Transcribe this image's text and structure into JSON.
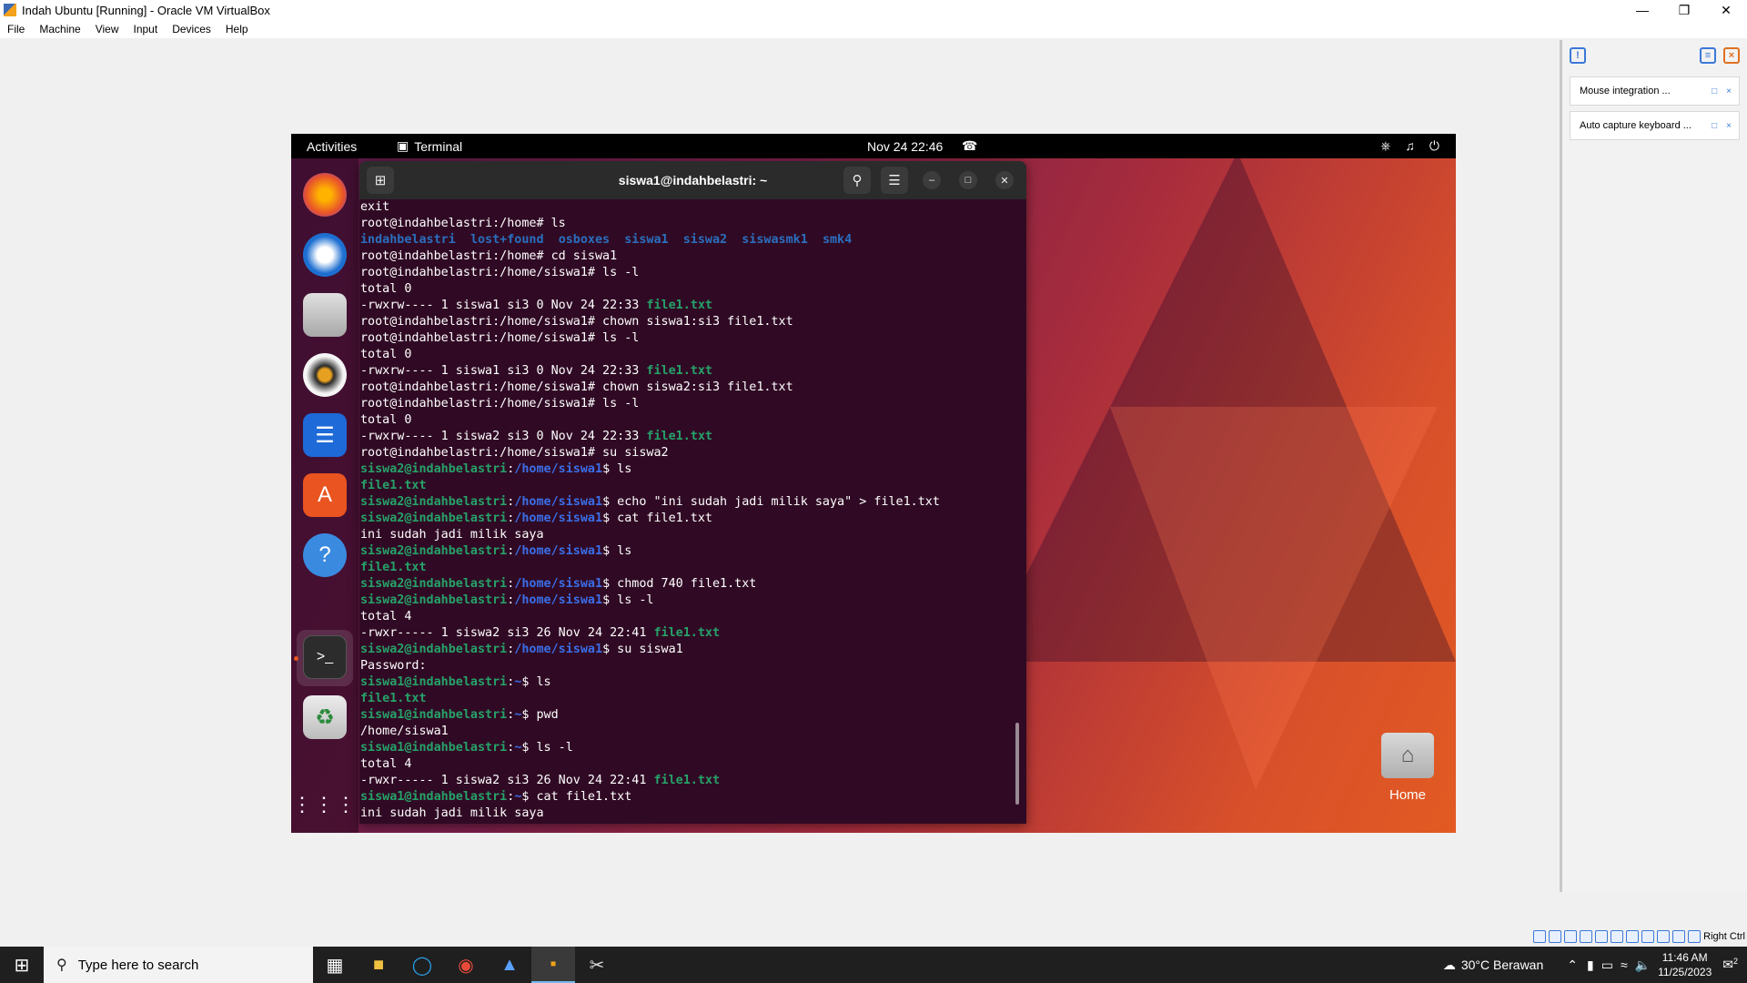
{
  "vbox": {
    "title": "Indah Ubuntu [Running] - Oracle VM VirtualBox",
    "menu": [
      "File",
      "Machine",
      "View",
      "Input",
      "Devices",
      "Help"
    ],
    "notifications": [
      {
        "label": "Mouse integration ..."
      },
      {
        "label": "Auto capture keyboard ..."
      }
    ],
    "host_key": "Right Ctrl"
  },
  "ubuntu": {
    "topbar": {
      "activities": "Activities",
      "app": "Terminal",
      "clock": "Nov 24  22:46"
    },
    "desktop_icon": "Home"
  },
  "terminal": {
    "title": "siswa1@indahbelastri: ~",
    "lines": [
      [
        {
          "t": "exit"
        }
      ],
      [
        {
          "t": "root@indahbelastri:/home# ls"
        }
      ],
      [
        {
          "t": "indahbelastri",
          "c": "d"
        },
        {
          "t": "  "
        },
        {
          "t": "lost+found",
          "c": "d"
        },
        {
          "t": "  "
        },
        {
          "t": "osboxes",
          "c": "d"
        },
        {
          "t": "  "
        },
        {
          "t": "siswa1",
          "c": "d"
        },
        {
          "t": "  "
        },
        {
          "t": "siswa2",
          "c": "d"
        },
        {
          "t": "  "
        },
        {
          "t": "siswasmk1",
          "c": "d"
        },
        {
          "t": "  "
        },
        {
          "t": "smk4",
          "c": "d"
        }
      ],
      [
        {
          "t": "root@indahbelastri:/home# cd siswa1"
        }
      ],
      [
        {
          "t": "root@indahbelastri:/home/siswa1# ls -l"
        }
      ],
      [
        {
          "t": "total 0"
        }
      ],
      [
        {
          "t": "-rwxrw---- 1 siswa1 si3 0 Nov 24 22:33 "
        },
        {
          "t": "file1.txt",
          "c": "g"
        }
      ],
      [
        {
          "t": "root@indahbelastri:/home/siswa1# chown siswa1:si3 file1.txt"
        }
      ],
      [
        {
          "t": "root@indahbelastri:/home/siswa1# ls -l"
        }
      ],
      [
        {
          "t": "total 0"
        }
      ],
      [
        {
          "t": "-rwxrw---- 1 siswa1 si3 0 Nov 24 22:33 "
        },
        {
          "t": "file1.txt",
          "c": "g"
        }
      ],
      [
        {
          "t": "root@indahbelastri:/home/siswa1# chown siswa2:si3 file1.txt"
        }
      ],
      [
        {
          "t": "root@indahbelastri:/home/siswa1# ls -l"
        }
      ],
      [
        {
          "t": "total 0"
        }
      ],
      [
        {
          "t": "-rwxrw---- 1 siswa2 si3 0 Nov 24 22:33 "
        },
        {
          "t": "file1.txt",
          "c": "g"
        }
      ],
      [
        {
          "t": "root@indahbelastri:/home/siswa1# su siswa2"
        }
      ],
      [
        {
          "t": "siswa2@indahbelastri",
          "c": "u"
        },
        {
          "t": ":"
        },
        {
          "t": "/home/siswa1",
          "c": "p"
        },
        {
          "t": "$ ls"
        }
      ],
      [
        {
          "t": "file1.txt",
          "c": "g"
        }
      ],
      [
        {
          "t": "siswa2@indahbelastri",
          "c": "u"
        },
        {
          "t": ":"
        },
        {
          "t": "/home/siswa1",
          "c": "p"
        },
        {
          "t": "$ echo \"ini sudah jadi milik saya\" > file1.txt"
        }
      ],
      [
        {
          "t": "siswa2@indahbelastri",
          "c": "u"
        },
        {
          "t": ":"
        },
        {
          "t": "/home/siswa1",
          "c": "p"
        },
        {
          "t": "$ cat file1.txt"
        }
      ],
      [
        {
          "t": "ini sudah jadi milik saya"
        }
      ],
      [
        {
          "t": "siswa2@indahbelastri",
          "c": "u"
        },
        {
          "t": ":"
        },
        {
          "t": "/home/siswa1",
          "c": "p"
        },
        {
          "t": "$ ls"
        }
      ],
      [
        {
          "t": "file1.txt",
          "c": "g"
        }
      ],
      [
        {
          "t": "siswa2@indahbelastri",
          "c": "u"
        },
        {
          "t": ":"
        },
        {
          "t": "/home/siswa1",
          "c": "p"
        },
        {
          "t": "$ chmod 740 file1.txt"
        }
      ],
      [
        {
          "t": "siswa2@indahbelastri",
          "c": "u"
        },
        {
          "t": ":"
        },
        {
          "t": "/home/siswa1",
          "c": "p"
        },
        {
          "t": "$ ls -l"
        }
      ],
      [
        {
          "t": "total 4"
        }
      ],
      [
        {
          "t": "-rwxr----- 1 siswa2 si3 26 Nov 24 22:41 "
        },
        {
          "t": "file1.txt",
          "c": "g"
        }
      ],
      [
        {
          "t": "siswa2@indahbelastri",
          "c": "u"
        },
        {
          "t": ":"
        },
        {
          "t": "/home/siswa1",
          "c": "p"
        },
        {
          "t": "$ su siswa1"
        }
      ],
      [
        {
          "t": "Password:"
        }
      ],
      [
        {
          "t": "siswa1@indahbelastri",
          "c": "u"
        },
        {
          "t": ":"
        },
        {
          "t": "~",
          "c": "p"
        },
        {
          "t": "$ ls"
        }
      ],
      [
        {
          "t": "file1.txt",
          "c": "g"
        }
      ],
      [
        {
          "t": "siswa1@indahbelastri",
          "c": "u"
        },
        {
          "t": ":"
        },
        {
          "t": "~",
          "c": "p"
        },
        {
          "t": "$ pwd"
        }
      ],
      [
        {
          "t": "/home/siswa1"
        }
      ],
      [
        {
          "t": "siswa1@indahbelastri",
          "c": "u"
        },
        {
          "t": ":"
        },
        {
          "t": "~",
          "c": "p"
        },
        {
          "t": "$ ls -l"
        }
      ],
      [
        {
          "t": "total 4"
        }
      ],
      [
        {
          "t": "-rwxr----- 1 siswa2 si3 26 Nov 24 22:41 "
        },
        {
          "t": "file1.txt",
          "c": "g"
        }
      ],
      [
        {
          "t": "siswa1@indahbelastri",
          "c": "u"
        },
        {
          "t": ":"
        },
        {
          "t": "~",
          "c": "p"
        },
        {
          "t": "$ cat file1.txt"
        }
      ],
      [
        {
          "t": "ini sudah jadi milik saya"
        }
      ]
    ]
  },
  "taskbar": {
    "search_placeholder": "Type here to search",
    "weather": "30°C  Berawan",
    "time": "11:46 AM",
    "date": "11/25/2023",
    "notif_count": "2"
  },
  "colors": {
    "accent": "#e95420",
    "terminal_bg": "#300a24",
    "prompt_user": "#26a269",
    "prompt_path": "#3a6ee8"
  }
}
